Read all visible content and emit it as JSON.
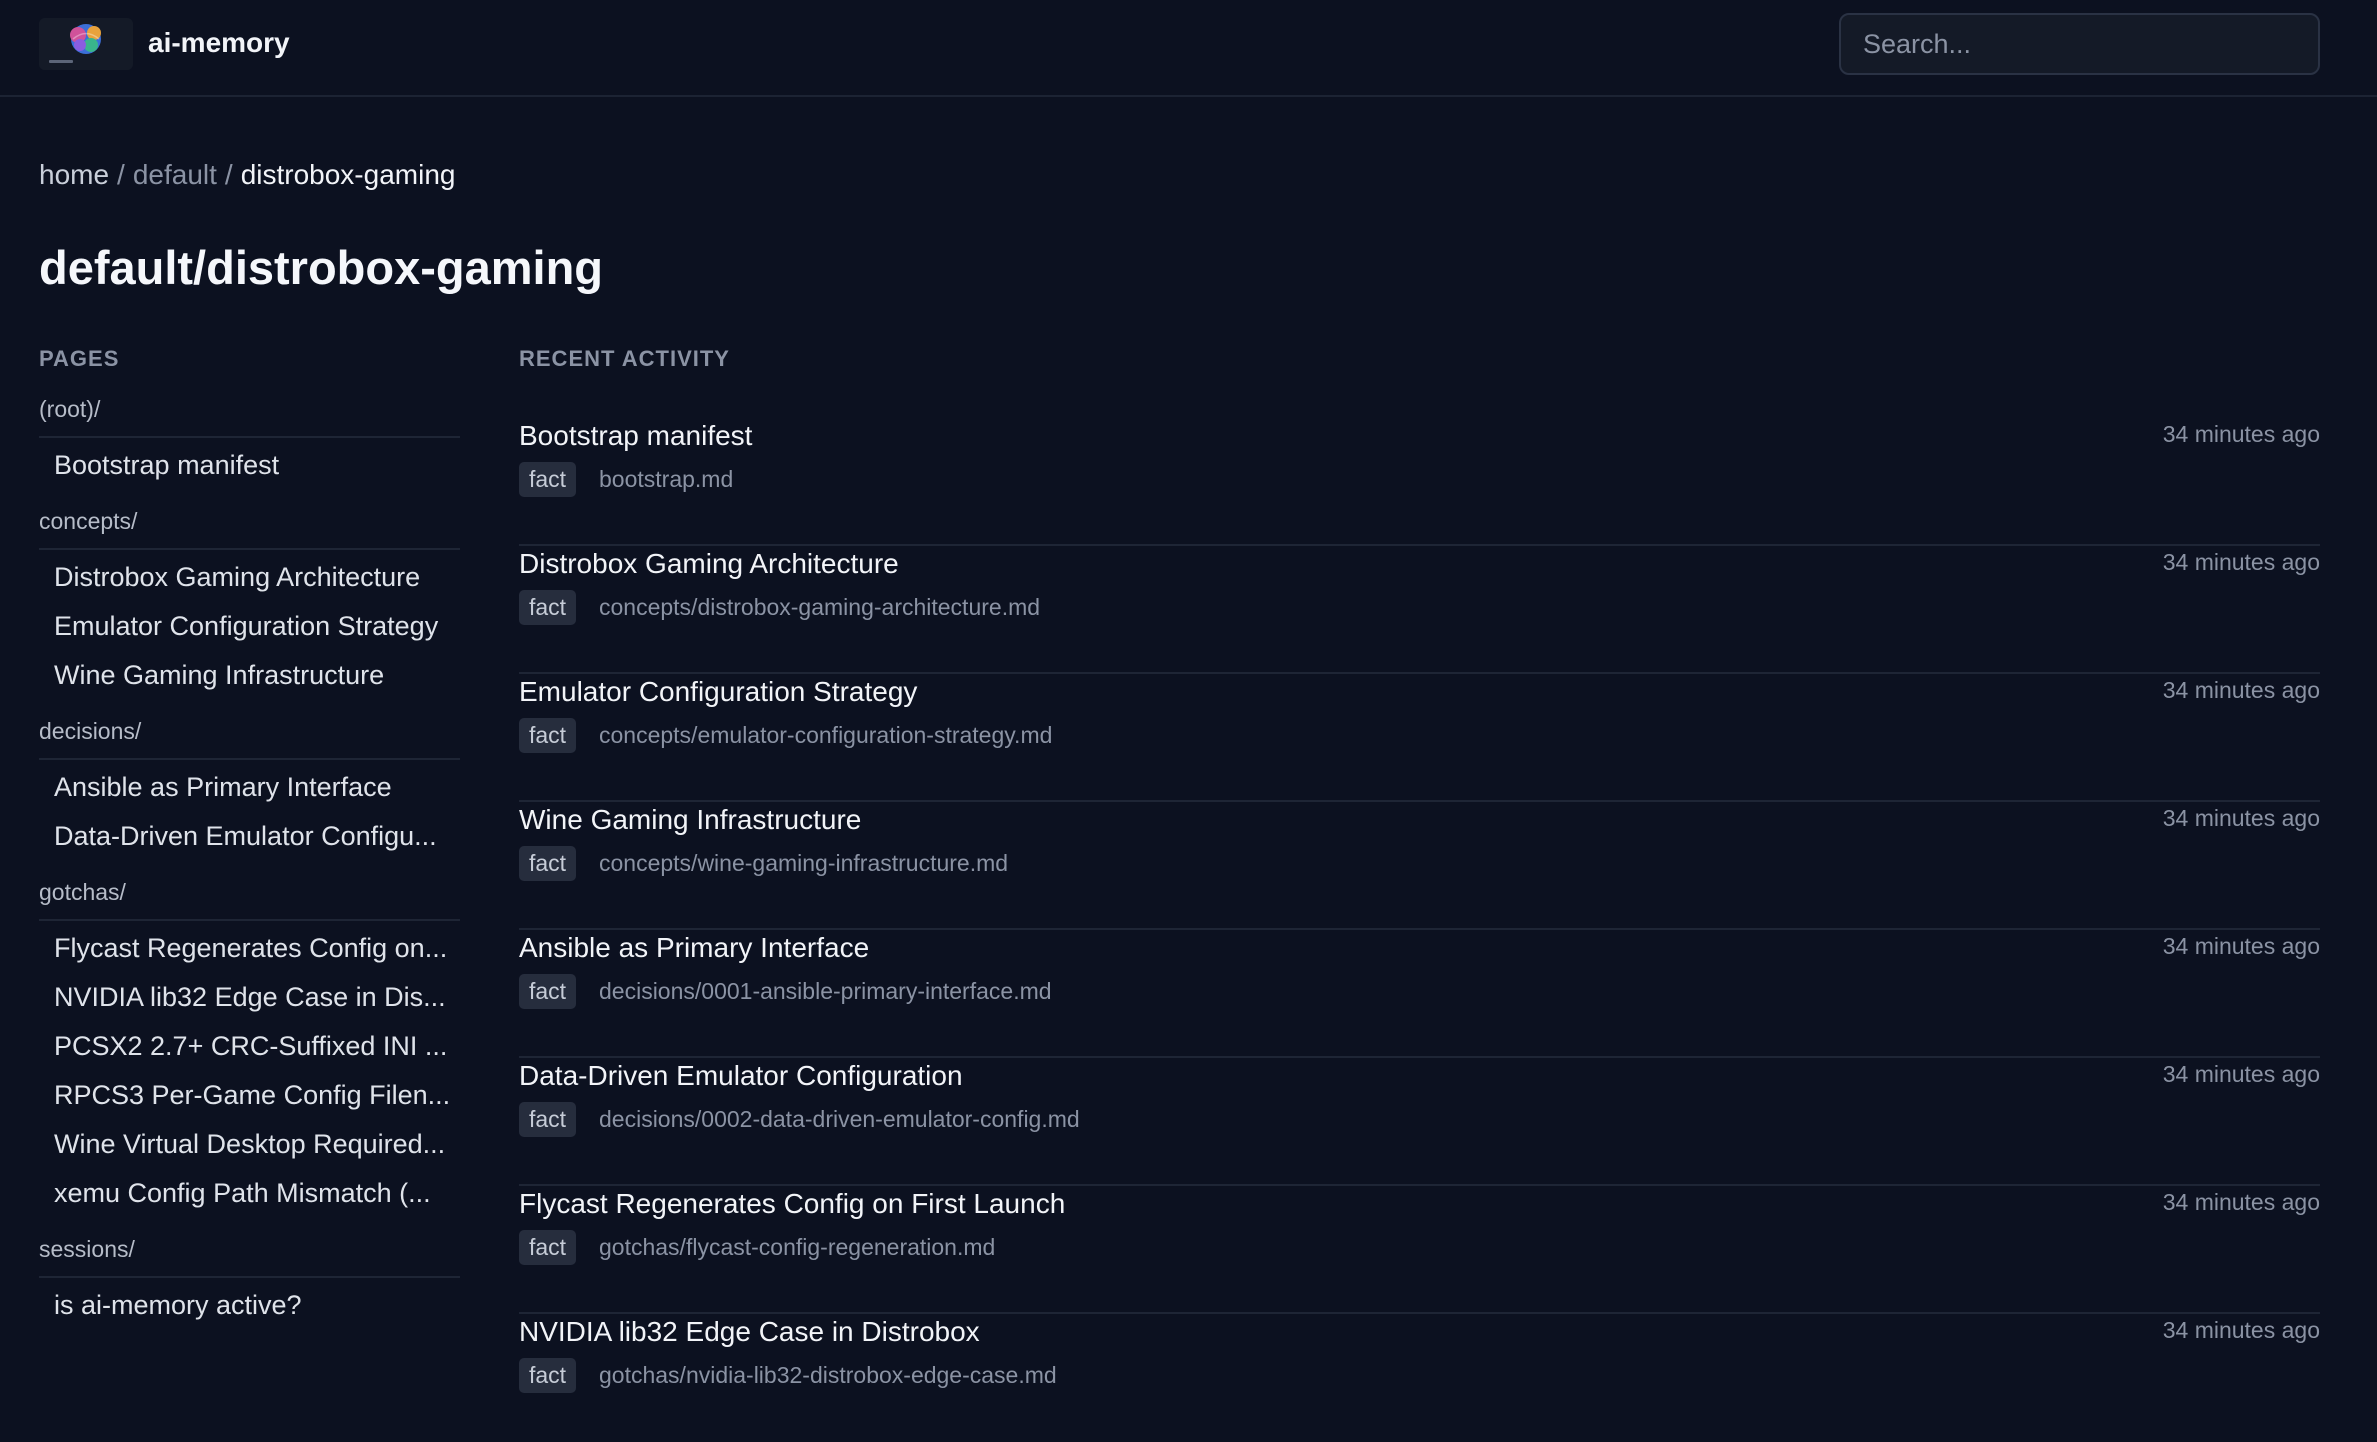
{
  "app": {
    "name": "ai-memory",
    "logo_icon": "brain-logo-icon"
  },
  "search": {
    "placeholder": "Search..."
  },
  "breadcrumb": {
    "home": "home",
    "namespace": "default",
    "current": "distrobox-gaming",
    "separator": "/"
  },
  "page_title": "default/distrobox-gaming",
  "sidebar": {
    "heading": "PAGES",
    "groups": [
      {
        "label": "(root)/",
        "items": [
          "Bootstrap manifest"
        ]
      },
      {
        "label": "concepts/",
        "items": [
          "Distrobox Gaming Architecture",
          "Emulator Configuration Strategy",
          "Wine Gaming Infrastructure"
        ]
      },
      {
        "label": "decisions/",
        "items": [
          "Ansible as Primary Interface",
          "Data-Driven Emulator Configu..."
        ]
      },
      {
        "label": "gotchas/",
        "items": [
          "Flycast Regenerates Config on...",
          "NVIDIA lib32 Edge Case in Dis...",
          "PCSX2 2.7+ CRC-Suffixed INI ...",
          "RPCS3 Per-Game Config Filen...",
          "Wine Virtual Desktop Required...",
          "xemu Config Path Mismatch (..."
        ]
      },
      {
        "label": "sessions/",
        "items": [
          "is ai-memory active?"
        ]
      }
    ]
  },
  "activity": {
    "heading": "RECENT ACTIVITY",
    "items": [
      {
        "title": "Bootstrap manifest",
        "type": "fact",
        "path": "bootstrap.md",
        "time": "34 minutes ago"
      },
      {
        "title": "Distrobox Gaming Architecture",
        "type": "fact",
        "path": "concepts/distrobox-gaming-architecture.md",
        "time": "34 minutes ago"
      },
      {
        "title": "Emulator Configuration Strategy",
        "type": "fact",
        "path": "concepts/emulator-configuration-strategy.md",
        "time": "34 minutes ago"
      },
      {
        "title": "Wine Gaming Infrastructure",
        "type": "fact",
        "path": "concepts/wine-gaming-infrastructure.md",
        "time": "34 minutes ago"
      },
      {
        "title": "Ansible as Primary Interface",
        "type": "fact",
        "path": "decisions/0001-ansible-primary-interface.md",
        "time": "34 minutes ago"
      },
      {
        "title": "Data-Driven Emulator Configuration",
        "type": "fact",
        "path": "decisions/0002-data-driven-emulator-config.md",
        "time": "34 minutes ago"
      },
      {
        "title": "Flycast Regenerates Config on First Launch",
        "type": "fact",
        "path": "gotchas/flycast-config-regeneration.md",
        "time": "34 minutes ago"
      },
      {
        "title": "NVIDIA lib32 Edge Case in Distrobox",
        "type": "fact",
        "path": "gotchas/nvidia-lib32-distrobox-edge-case.md",
        "time": "34 minutes ago"
      }
    ]
  },
  "colors": {
    "background": "#0c1120",
    "border": "#1e2535",
    "muted_text": "#8b93a4",
    "badge_bg": "#262d3d"
  }
}
